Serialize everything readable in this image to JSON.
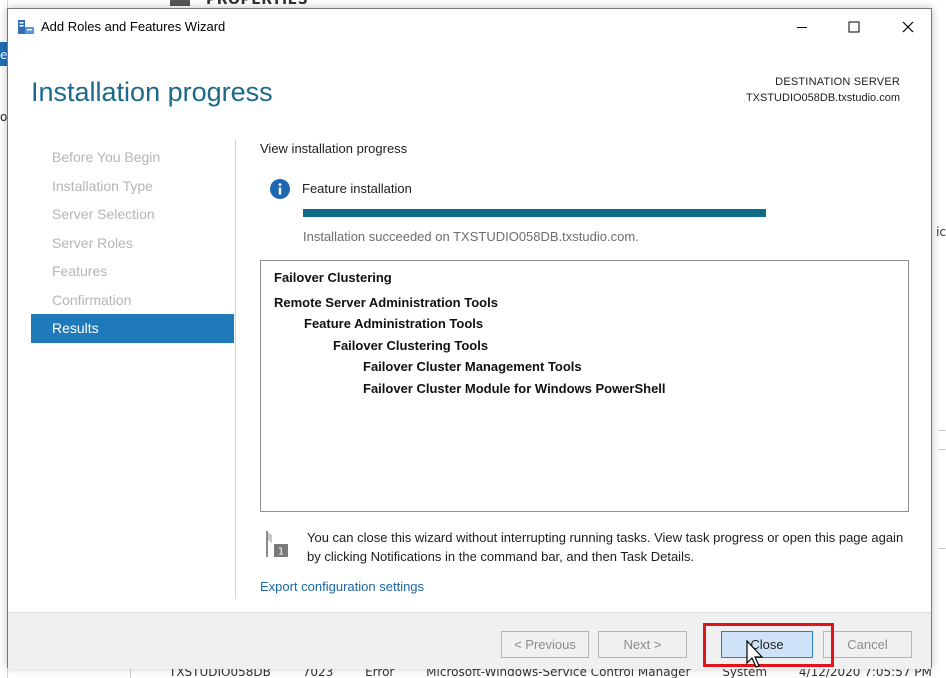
{
  "background": {
    "properties_label": "PROPERTIES",
    "left_letters": [
      "e",
      "o"
    ],
    "right_letter": "ic",
    "bottom_row": [
      "TXSTUDIO058DB",
      "7023",
      "Error",
      "Microsoft-Windows-Service Control Manager",
      "System",
      "4/12/2020 7:05:57 PM"
    ]
  },
  "window": {
    "title": "Add Roles and Features Wizard",
    "controls": {
      "minimize": "minimize",
      "maximize": "maximize",
      "close": "close"
    }
  },
  "header": {
    "title": "Installation progress",
    "destination_label": "DESTINATION SERVER",
    "destination_value": "TXSTUDIO058DB.txstudio.com"
  },
  "nav": {
    "items": [
      {
        "label": "Before You Begin",
        "active": false
      },
      {
        "label": "Installation Type",
        "active": false
      },
      {
        "label": "Server Selection",
        "active": false
      },
      {
        "label": "Server Roles",
        "active": false
      },
      {
        "label": "Features",
        "active": false
      },
      {
        "label": "Confirmation",
        "active": false
      },
      {
        "label": "Results",
        "active": true
      }
    ]
  },
  "content": {
    "heading": "View installation progress",
    "feature_label": "Feature installation",
    "progress_fraction": 1.0,
    "status": "Installation succeeded on TXSTUDIO058DB.txstudio.com.",
    "results": [
      {
        "text": "Failover Clustering",
        "level": 0
      },
      {
        "text": "Remote Server Administration Tools",
        "level": 0
      },
      {
        "text": "Feature Administration Tools",
        "level": 1
      },
      {
        "text": "Failover Clustering Tools",
        "level": 2
      },
      {
        "text": "Failover Cluster Management Tools",
        "level": 3
      },
      {
        "text": "Failover Cluster Module for Windows PowerShell",
        "level": 3
      }
    ],
    "note": "You can close this wizard without interrupting running tasks. View task progress or open this page again by clicking Notifications in the command bar, and then Task Details.",
    "flag_badge": "1",
    "export_link": "Export configuration settings"
  },
  "footer": {
    "previous": "< Previous",
    "next": "Next >",
    "close": "Close",
    "cancel": "Cancel"
  },
  "colors": {
    "accent": "#1b6a8c",
    "nav_active": "#1e7ab8",
    "progress": "#0e6b88",
    "highlight": "#e0141a",
    "link": "#1a66a8"
  }
}
